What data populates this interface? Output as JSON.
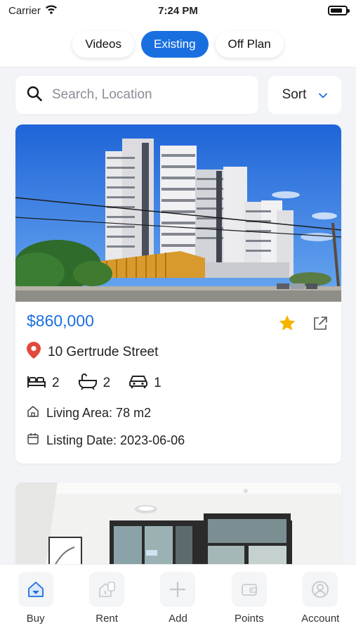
{
  "status": {
    "carrier": "Carrier",
    "time": "7:24 PM"
  },
  "tabs": [
    {
      "label": "Videos",
      "active": false
    },
    {
      "label": "Existing",
      "active": true
    },
    {
      "label": "Off Plan",
      "active": false
    }
  ],
  "search": {
    "placeholder": "Search, Location",
    "value": ""
  },
  "sort": {
    "label": "Sort"
  },
  "listings": [
    {
      "price": "$860,000",
      "address": "10 Gertrude Street",
      "beds": "2",
      "baths": "2",
      "cars": "1",
      "living_area": "Living Area: 78 m2",
      "listing_date": "Listing Date: 2023-06-06",
      "favorite": true
    }
  ],
  "nav": [
    {
      "label": "Buy",
      "icon": "home-icon",
      "active": true
    },
    {
      "label": "Rent",
      "icon": "rent-icon",
      "active": false
    },
    {
      "label": "Add",
      "icon": "plus-icon",
      "active": false
    },
    {
      "label": "Points",
      "icon": "wallet-icon",
      "active": false
    },
    {
      "label": "Account",
      "icon": "user-icon",
      "active": false
    }
  ],
  "colors": {
    "accent": "#1a6fe0",
    "star": "#f5b400",
    "pin": "#e2483c"
  }
}
